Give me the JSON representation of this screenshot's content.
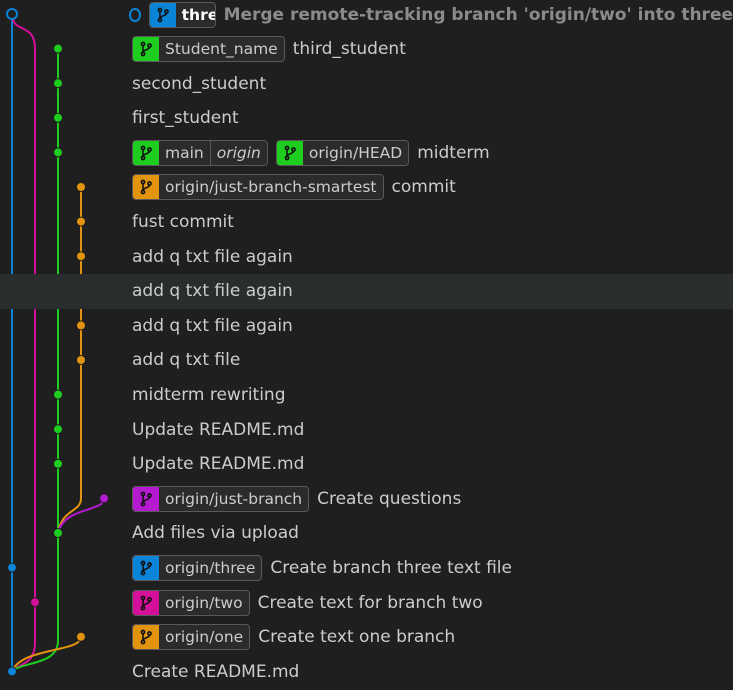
{
  "colors": {
    "blue": "#0a84d6",
    "magenta": "#d4109b",
    "green": "#1ece1e",
    "orange": "#e3940e",
    "purple": "#b51ad0"
  },
  "commits": [
    {
      "message": "Merge remote-tracking branch 'origin/two' into three",
      "is_head": true,
      "refs": [
        {
          "name": "three",
          "color": "#0a84d6",
          "current": true,
          "icon": "branch-icon"
        }
      ]
    },
    {
      "message": "third_student",
      "refs": [
        {
          "name": "Student_name",
          "color": "#1ece1e",
          "icon": "branch-icon"
        }
      ]
    },
    {
      "message": "second_student",
      "refs": []
    },
    {
      "message": "first_student",
      "refs": []
    },
    {
      "message": "midterm",
      "refs": [
        {
          "name": "main",
          "remote": "origin",
          "color": "#1ece1e",
          "icon": "branch-icon"
        },
        {
          "name": "origin/HEAD",
          "color": "#1ece1e",
          "icon": "branch-icon"
        }
      ]
    },
    {
      "message": "commit",
      "refs": [
        {
          "name": "origin/just-branch-smartest",
          "color": "#e3940e",
          "icon": "branch-icon"
        }
      ]
    },
    {
      "message": "fust commit",
      "refs": []
    },
    {
      "message": "add q txt file again",
      "refs": []
    },
    {
      "message": "add q txt file again",
      "refs": [],
      "highlight": true
    },
    {
      "message": "add q txt file again",
      "refs": []
    },
    {
      "message": "add q txt file",
      "refs": []
    },
    {
      "message": "midterm rewriting",
      "refs": []
    },
    {
      "message": "Update README.md",
      "refs": []
    },
    {
      "message": "Update README.md",
      "refs": []
    },
    {
      "message": "Create questions",
      "refs": [
        {
          "name": "origin/just-branch",
          "color": "#b51ad0",
          "icon": "branch-icon"
        }
      ]
    },
    {
      "message": "Add files via upload",
      "refs": []
    },
    {
      "message": "Create branch three text file",
      "refs": [
        {
          "name": "origin/three",
          "color": "#0a84d6",
          "icon": "branch-icon"
        }
      ]
    },
    {
      "message": "Create text for branch two",
      "refs": [
        {
          "name": "origin/two",
          "color": "#d4109b",
          "icon": "branch-icon"
        }
      ]
    },
    {
      "message": "Create text one branch",
      "refs": [
        {
          "name": "origin/one",
          "color": "#e3940e",
          "icon": "branch-icon"
        }
      ]
    },
    {
      "message": "Create README.md",
      "refs": []
    }
  ]
}
